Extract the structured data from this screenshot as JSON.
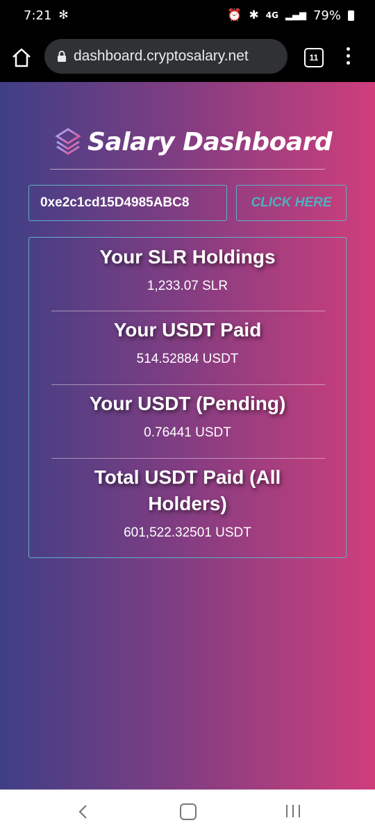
{
  "status_bar": {
    "time": "7:21",
    "network": "4G",
    "battery": "79%"
  },
  "browser": {
    "url": "dashboard.cryptosalary.net",
    "tab_count": "11"
  },
  "dashboard": {
    "title": "Salary Dashboard",
    "wallet_address": "0xe2c1cd15D4985ABC8",
    "click_button": "CLICK HERE",
    "stats": [
      {
        "title": "Your SLR Holdings",
        "value": "1,233.07 SLR"
      },
      {
        "title": "Your USDT Paid",
        "value": "514.52884 USDT"
      },
      {
        "title": "Your USDT (Pending)",
        "value": "0.76441 USDT"
      },
      {
        "title": "Total USDT Paid (All Holders)",
        "value": "601,522.32501 USDT"
      }
    ]
  },
  "colors": {
    "gradient_left": "#3f3f86",
    "gradient_right": "#cf3e7b",
    "accent": "#4fb0bf"
  }
}
